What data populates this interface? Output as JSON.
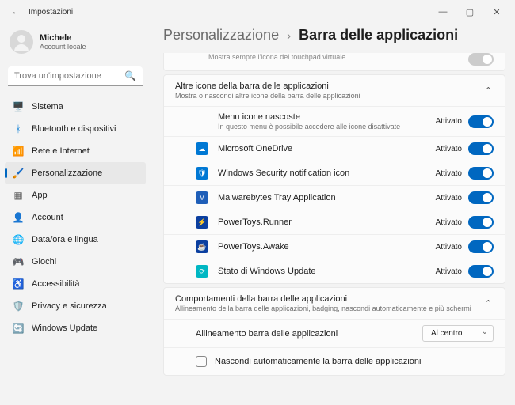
{
  "window": {
    "title": "Impostazioni"
  },
  "profile": {
    "name": "Michele",
    "sub": "Account locale"
  },
  "search": {
    "placeholder": "Trova un'impostazione"
  },
  "nav": [
    {
      "label": "Sistema",
      "icon": "🖥️",
      "name": "sidebar-item-system"
    },
    {
      "label": "Bluetooth e dispositivi",
      "icon": "ᚼ",
      "iconColor": "#0078d4",
      "name": "sidebar-item-bluetooth"
    },
    {
      "label": "Rete e Internet",
      "icon": "📶",
      "name": "sidebar-item-network"
    },
    {
      "label": "Personalizzazione",
      "icon": "🖌️",
      "name": "sidebar-item-personalization",
      "active": true
    },
    {
      "label": "App",
      "icon": "▦",
      "iconColor": "#666",
      "name": "sidebar-item-apps"
    },
    {
      "label": "Account",
      "icon": "👤",
      "name": "sidebar-item-account"
    },
    {
      "label": "Data/ora e lingua",
      "icon": "🌐",
      "name": "sidebar-item-time-lang"
    },
    {
      "label": "Giochi",
      "icon": "🎮",
      "name": "sidebar-item-gaming"
    },
    {
      "label": "Accessibilità",
      "icon": "♿",
      "name": "sidebar-item-accessibility"
    },
    {
      "label": "Privacy e sicurezza",
      "icon": "🛡️",
      "name": "sidebar-item-privacy"
    },
    {
      "label": "Windows Update",
      "icon": "🔄",
      "name": "sidebar-item-update"
    }
  ],
  "breadcrumb": {
    "parent": "Personalizzazione",
    "current": "Barra delle applicazioni"
  },
  "truncated_row": {
    "text": "Mostra sempre l'icona del touchpad virtuale"
  },
  "section_icons": {
    "title": "Altre icone della barra delle applicazioni",
    "subtitle": "Mostra o nascondi altre icone della barra delle applicazioni",
    "items": [
      {
        "label": "Menu icone nascoste",
        "sub": "In questo menu è possibile accedere alle icone disattivate",
        "state": "Attivato",
        "iconClass": "",
        "noIcon": true
      },
      {
        "label": "Microsoft OneDrive",
        "state": "Attivato",
        "iconClass": "ic-blue",
        "glyph": "☁"
      },
      {
        "label": "Windows Security notification icon",
        "state": "Attivato",
        "iconClass": "ic-blue",
        "glyph": "🛡"
      },
      {
        "label": "Malwarebytes Tray Application",
        "state": "Attivato",
        "iconClass": "ic-dblue",
        "glyph": "M"
      },
      {
        "label": "PowerToys.Runner",
        "state": "Attivato",
        "iconClass": "ic-navy",
        "glyph": "⚡"
      },
      {
        "label": "PowerToys.Awake",
        "state": "Attivato",
        "iconClass": "ic-navy",
        "glyph": "☕"
      },
      {
        "label": "Stato di Windows Update",
        "state": "Attivato",
        "iconClass": "ic-teal",
        "glyph": "⟳"
      }
    ]
  },
  "section_behavior": {
    "title": "Comportamenti della barra delle applicazioni",
    "subtitle": "Allineamento della barra delle applicazioni, badging, nascondi automaticamente e più schermi",
    "alignment_label": "Allineamento barra delle applicazioni",
    "alignment_value": "Al centro",
    "autohide_label": "Nascondi automaticamente la barra delle applicazioni"
  }
}
